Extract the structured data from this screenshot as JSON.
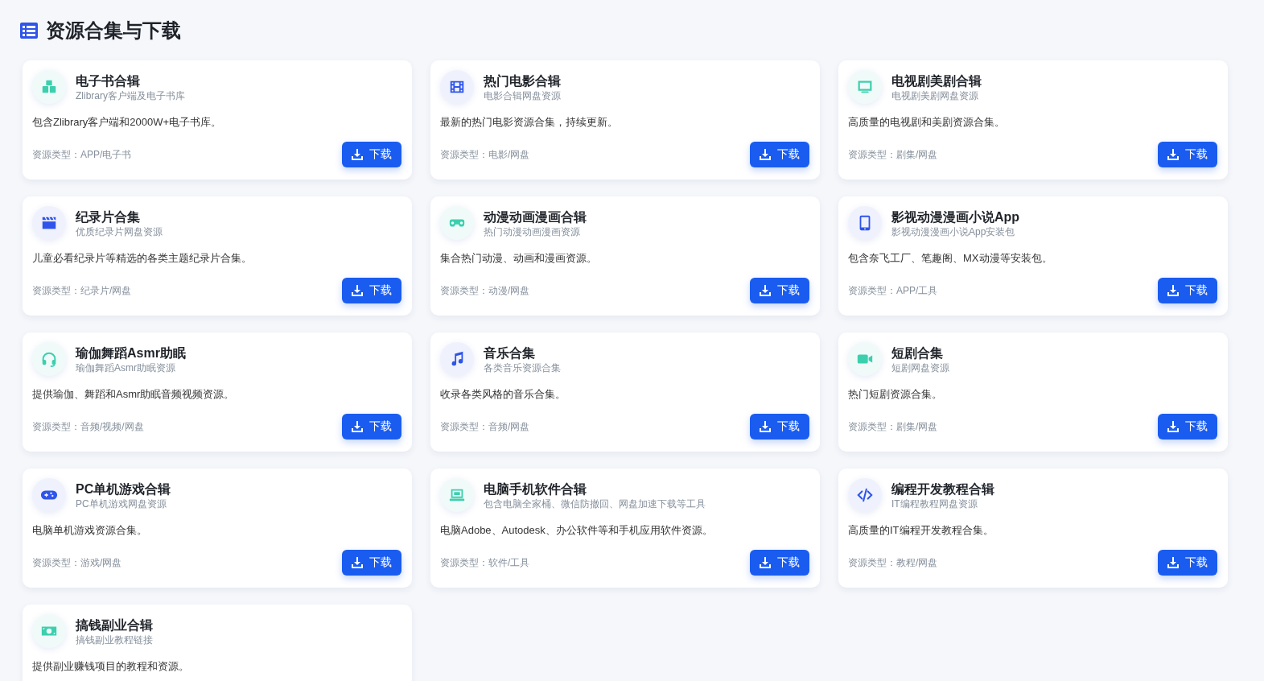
{
  "header": {
    "title": "资源合集与下载"
  },
  "cards": [
    {
      "kind": "cubes",
      "color": "#3ccfae",
      "title": "电子书合辑",
      "subtitle": "Zlibrary客户端及电子书库",
      "description": "包含Zlibrary客户端和2000W+电子书库。",
      "type_label": "资源类型：APP/电子书",
      "button": "下载"
    },
    {
      "kind": "film",
      "color": "#2f54eb",
      "title": "热门电影合辑",
      "subtitle": "电影合辑网盘资源",
      "description": "最新的热门电影资源合集，持续更新。",
      "type_label": "资源类型：电影/网盘",
      "button": "下载"
    },
    {
      "kind": "tv",
      "color": "#3ccfae",
      "title": "电视剧美剧合辑",
      "subtitle": "电视剧美剧网盘资源",
      "description": "高质量的电视剧和美剧资源合集。",
      "type_label": "资源类型：剧集/网盘",
      "button": "下载"
    },
    {
      "kind": "clapper",
      "color": "#2f54eb",
      "title": "纪录片合集",
      "subtitle": "优质纪录片网盘资源",
      "description": "儿童必看纪录片等精选的各类主题纪录片合集。",
      "type_label": "资源类型：纪录片/网盘",
      "button": "下载"
    },
    {
      "kind": "goggles",
      "color": "#3ccfae",
      "title": "动漫动画漫画合辑",
      "subtitle": "热门动漫动画漫画资源",
      "description": "集合热门动漫、动画和漫画资源。",
      "type_label": "资源类型：动漫/网盘",
      "button": "下载"
    },
    {
      "kind": "phone",
      "color": "#2f54eb",
      "title": "影视动漫漫画小说App",
      "subtitle": "影视动漫漫画小说App安装包",
      "description": "包含奈飞工厂、笔趣阁、MX动漫等安装包。",
      "type_label": "资源类型：APP/工具",
      "button": "下载"
    },
    {
      "kind": "headset",
      "color": "#3ccfae",
      "title": "瑜伽舞蹈Asmr助眠",
      "subtitle": "瑜伽舞蹈Asmr助眠资源",
      "description": "提供瑜伽、舞蹈和Asmr助眠音频视频资源。",
      "type_label": "资源类型：音频/视频/网盘",
      "button": "下载"
    },
    {
      "kind": "music",
      "color": "#2f54eb",
      "title": "音乐合集",
      "subtitle": "各类音乐资源合集",
      "description": "收录各类风格的音乐合集。",
      "type_label": "资源类型：音频/网盘",
      "button": "下载"
    },
    {
      "kind": "camera",
      "color": "#3ccfae",
      "title": "短剧合集",
      "subtitle": "短剧网盘资源",
      "description": "热门短剧资源合集。",
      "type_label": "资源类型：剧集/网盘",
      "button": "下载"
    },
    {
      "kind": "gamepad",
      "color": "#2f54eb",
      "title": "PC单机游戏合辑",
      "subtitle": "PC单机游戏网盘资源",
      "description": "电脑单机游戏资源合集。",
      "type_label": "资源类型：游戏/网盘",
      "button": "下载"
    },
    {
      "kind": "laptop",
      "color": "#3ccfae",
      "title": "电脑手机软件合辑",
      "subtitle": "包含电脑全家桶、微信防撤回、网盘加速下载等工具",
      "description": "电脑Adobe、Autodesk、办公软件等和手机应用软件资源。",
      "type_label": "资源类型：软件/工具",
      "button": "下载"
    },
    {
      "kind": "code",
      "color": "#2f54eb",
      "title": "编程开发教程合辑",
      "subtitle": "IT编程教程网盘资源",
      "description": "高质量的IT编程开发教程合集。",
      "type_label": "资源类型：教程/网盘",
      "button": "下载"
    },
    {
      "kind": "money",
      "color": "#3ccfae",
      "title": "搞钱副业合辑",
      "subtitle": "搞钱副业教程链接",
      "description": "提供副业赚钱项目的教程和资源。"
    }
  ]
}
